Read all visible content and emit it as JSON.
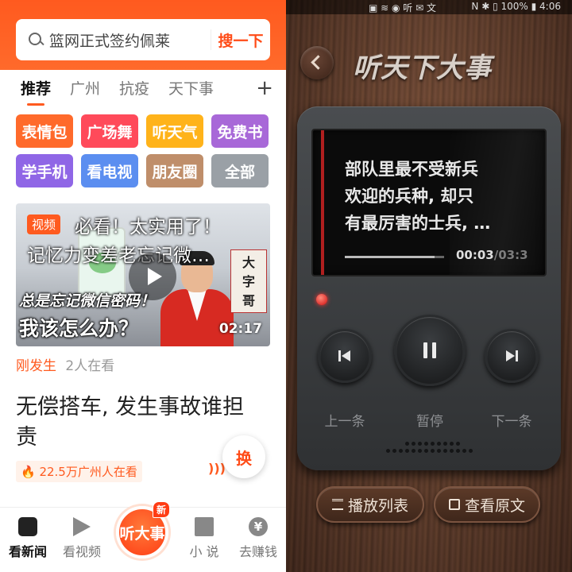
{
  "left": {
    "search": {
      "placeholder": "篮网正式签约佩莱",
      "button": "搜一下"
    },
    "tabs": [
      {
        "label": "推荐",
        "active": true
      },
      {
        "label": "广州"
      },
      {
        "label": "抗疫"
      },
      {
        "label": "天下事"
      }
    ],
    "tab_more": "+",
    "chips": [
      {
        "label": "表情包",
        "color": "#ff6a2b"
      },
      {
        "label": "广场舞",
        "color": "#ff4a5a"
      },
      {
        "label": "听天气",
        "color": "#ffb31a"
      },
      {
        "label": "免费书",
        "color": "#a868d8"
      },
      {
        "label": "学手机",
        "color": "#8f66e6"
      },
      {
        "label": "看电视",
        "color": "#5b8ef0"
      },
      {
        "label": "朋友圈",
        "color": "#bf8e6a"
      },
      {
        "label": "全部",
        "color": "#9aa0a6"
      }
    ],
    "video": {
      "badge": "视频",
      "title_line1": "必看！太实用了！",
      "title_line2": "记忆力变差老忘记微…",
      "caption_line1": "总是忘记微信密码！",
      "caption_line2": "我该怎么办？",
      "duration": "02:17",
      "sign_text": [
        "大",
        "字",
        "哥"
      ],
      "status": "刚发生",
      "viewers": "2人在看"
    },
    "article": {
      "headline": "无偿搭车, 发生事故谁担责",
      "viewers": "🔥 22.5万广州人在看"
    },
    "swap_label": "换",
    "bottom_nav": [
      {
        "label": "看新闻",
        "active": true,
        "icon": "news-icon"
      },
      {
        "label": "看视频",
        "icon": "video-icon"
      },
      {
        "label": "小 说",
        "icon": "book-icon"
      },
      {
        "label": "去赚钱",
        "icon": "yen-icon"
      }
    ],
    "center_nav": {
      "label": "听大事",
      "badge": "新"
    }
  },
  "right": {
    "status_left": "▣ ≋ ◉ 听 ✉ 文",
    "status_right": "N ✱ ▯ 100% ▮ 4:06",
    "title": "听天下大事",
    "lyric": [
      "部队里最不受新兵",
      "欢迎的兵种, 却只",
      "有最厉害的士兵, …"
    ],
    "progress": 0.9,
    "time_current": "00:03",
    "time_total": "/03:3",
    "controls": {
      "prev": "上一条",
      "pause": "暂停",
      "next": "下一条"
    },
    "playlist_button": "播放列表",
    "original_button": "查看原文"
  }
}
